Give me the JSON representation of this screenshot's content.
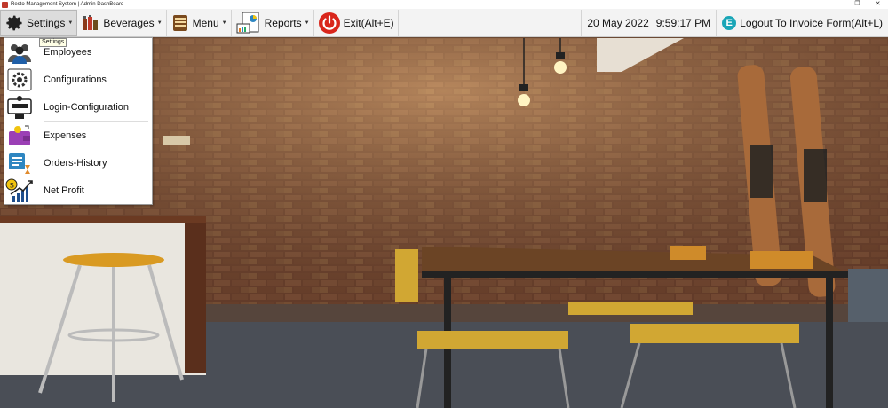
{
  "window": {
    "title": "Resto Management System  | Admin DashBoard",
    "controls": [
      "–",
      "❐",
      "✕"
    ]
  },
  "menubar": {
    "settings_label": "Settings",
    "beverages_label": "Beverages",
    "menu_label": "Menu",
    "reports_label": "Reports",
    "exit_label": "Exit(Alt+E)",
    "date": "20 May 2022",
    "time": "9:59:17 PM",
    "logout_label": "Logout To Invoice Form(Alt+L)"
  },
  "tooltip": "Settings",
  "settings_menu": {
    "items": [
      {
        "label": "Employees",
        "icon": "employees-icon"
      },
      {
        "label": "Configurations",
        "icon": "gear-config-icon"
      },
      {
        "label": "Login-Configuration",
        "icon": "login-config-icon"
      },
      {
        "label": "Expenses",
        "icon": "wallet-icon"
      },
      {
        "label": "Orders-History",
        "icon": "orders-history-icon"
      },
      {
        "label": "Net Profit",
        "icon": "profit-chart-icon"
      }
    ]
  },
  "colors": {
    "accent_exit": "#d9261c",
    "logout_icon": "#1aa6b7",
    "menubar_bg": "#f3f3f3"
  }
}
